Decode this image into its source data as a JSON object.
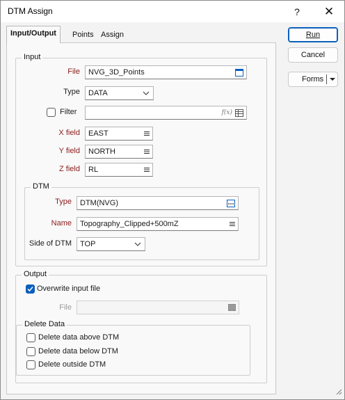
{
  "window": {
    "title": "DTM Assign",
    "help": "?",
    "close": "✕"
  },
  "tabs": [
    "Input/Output",
    "Points",
    "Assign"
  ],
  "input": {
    "group_title": "Input",
    "file_label": "File",
    "file_value": "NVG_3D_Points",
    "type_label": "Type",
    "type_value": "DATA",
    "filter_label": "Filter",
    "filter_value": "",
    "filter_fx": "f(x)",
    "xfield_label": "X field",
    "xfield_value": "EAST",
    "yfield_label": "Y field",
    "yfield_value": "NORTH",
    "zfield_label": "Z field",
    "zfield_value": "RL"
  },
  "dtm": {
    "group_title": "DTM",
    "type_label": "Type",
    "type_value": "DTM(NVG)",
    "name_label": "Name",
    "name_value": "Topography_Clipped+500mZ",
    "side_label": "Side of DTM",
    "side_value": "TOP"
  },
  "output": {
    "group_title": "Output",
    "overwrite_label": "Overwrite input file",
    "overwrite_checked": true,
    "file_label": "File",
    "file_value": ""
  },
  "delete_data": {
    "group_title": "Delete Data",
    "above_label": "Delete data above DTM",
    "below_label": "Delete data below DTM",
    "outside_label": "Delete outside DTM"
  },
  "buttons": {
    "run": "Run",
    "cancel": "Cancel",
    "forms": "Forms"
  },
  "colors": {
    "accent": "#0b5fbd",
    "required_label": "#8b1a1a"
  }
}
